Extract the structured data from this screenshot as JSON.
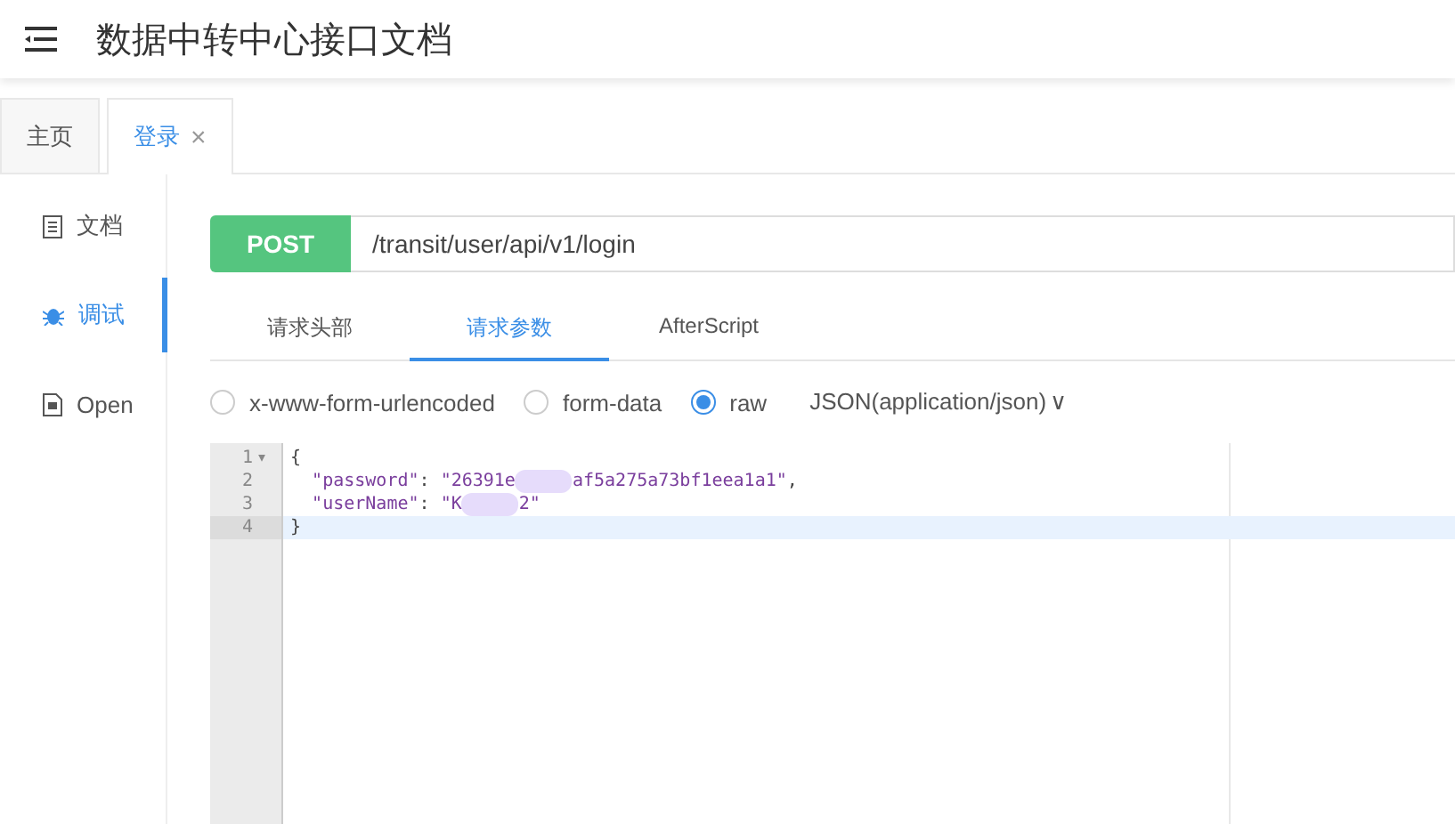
{
  "header": {
    "title": "数据中转中心接口文档"
  },
  "page_tabs": [
    {
      "label": "主页",
      "selected": false
    },
    {
      "label": "登录",
      "selected": true,
      "close": "×"
    }
  ],
  "sidebar": {
    "items": [
      {
        "label": "文档",
        "kind": "doc",
        "selected": false
      },
      {
        "label": "调试",
        "kind": "debug",
        "selected": true
      },
      {
        "label": "Open",
        "kind": "file",
        "selected": false
      }
    ]
  },
  "request": {
    "method": "POST",
    "url": "/transit/user/api/v1/login"
  },
  "request_tabs": [
    {
      "label": "请求头部",
      "selected": false
    },
    {
      "label": "请求参数",
      "selected": true
    },
    {
      "label": "AfterScript",
      "selected": false
    }
  ],
  "body_types": [
    {
      "label": "x-www-form-urlencoded",
      "selected": false
    },
    {
      "label": "form-data",
      "selected": false
    },
    {
      "label": "raw",
      "selected": true
    }
  ],
  "content_type": {
    "value": "JSON(application/json)",
    "caret": "∨"
  },
  "editor": {
    "lines": [
      {
        "number": "1",
        "fold": "▾",
        "parts": [
          {
            "kind": "punct",
            "text": "{"
          }
        ],
        "active": false
      },
      {
        "number": "2",
        "parts": [
          {
            "kind": "key",
            "text": "\"password\""
          },
          {
            "kind": "punct",
            "text": ": "
          },
          {
            "kind": "string",
            "text": "\"26391e"
          },
          {
            "kind": "mask"
          },
          {
            "kind": "string",
            "text": "af5a275a73bf1eea1a1\""
          },
          {
            "kind": "punct",
            "text": ","
          }
        ],
        "active": false
      },
      {
        "number": "3",
        "parts": [
          {
            "kind": "key",
            "text": "\"userName\""
          },
          {
            "kind": "punct",
            "text": ": "
          },
          {
            "kind": "string",
            "text": "\"K"
          },
          {
            "kind": "mask"
          },
          {
            "kind": "string",
            "text": "2\""
          }
        ],
        "active": false
      },
      {
        "number": "4",
        "parts": [
          {
            "kind": "punct",
            "text": "}"
          }
        ],
        "active": true
      }
    ]
  }
}
